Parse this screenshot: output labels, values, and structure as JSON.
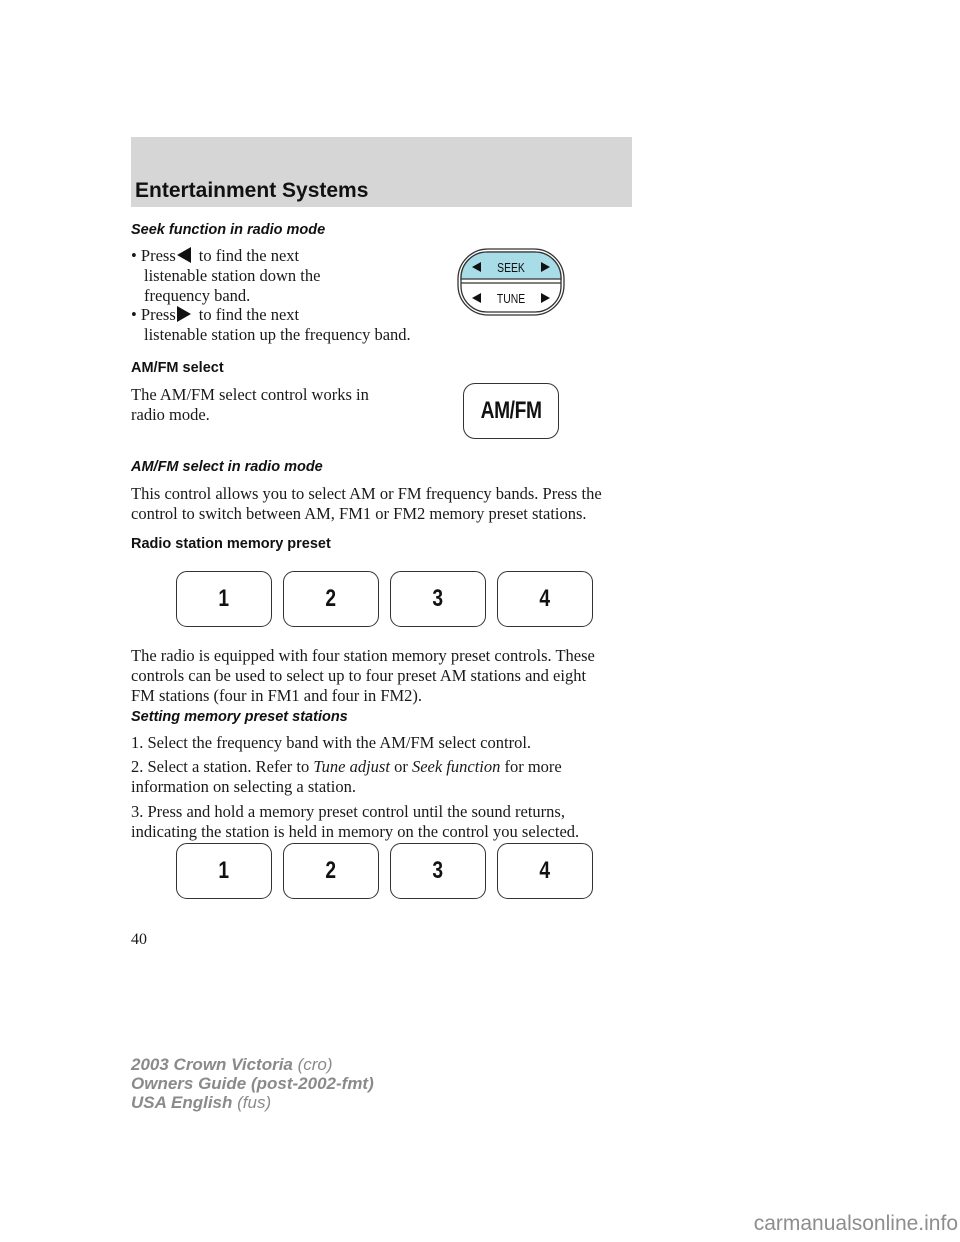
{
  "header": {
    "section_title": "Entertainment Systems"
  },
  "seek": {
    "heading": "Seek function in radio mode",
    "bullets": [
      {
        "prefix": "Press",
        "icon": "triangle-left-icon",
        "line1": "to find the next",
        "line2": "listenable station down the",
        "line3": "frequency band."
      },
      {
        "prefix": "Press",
        "icon": "triangle-right-icon",
        "line1": "to find the next",
        "line2": "listenable station up the frequency band."
      }
    ],
    "control": {
      "seek_label": "SEEK",
      "tune_label": "TUNE",
      "seek_color": "#a8dde8"
    }
  },
  "amfm": {
    "heading": "AM/FM select",
    "text_line1": "The AM/FM select control works in",
    "text_line2": "radio mode.",
    "button_label": "AM/FM"
  },
  "amfm_radio": {
    "heading": "AM/FM select in radio mode",
    "text_line1": "This control allows you to select AM or FM frequency bands. Press the",
    "text_line2": "control to switch between AM, FM1 or FM2 memory preset stations."
  },
  "presets": {
    "heading": "Radio station memory preset",
    "buttons": [
      "1",
      "2",
      "3",
      "4"
    ],
    "text_line1": "The radio is equipped with four station memory preset controls. These",
    "text_line2": "controls can be used to select up to four preset AM stations and eight",
    "text_line3": "FM stations (four in FM1 and four in FM2)."
  },
  "setting": {
    "heading": "Setting memory preset stations",
    "step1": "1. Select the frequency band with the AM/FM select control.",
    "step2_a": "2. Select a station. Refer to ",
    "step2_link1": "Tune adjust",
    "step2_b": " or ",
    "step2_link2": "Seek function",
    "step2_c": " for more",
    "step2_line2": "information on selecting a station.",
    "step3_line1": "3. Press and hold a memory preset control until the sound returns,",
    "step3_line2": "indicating the station is held in memory on the control you selected.",
    "buttons": [
      "1",
      "2",
      "3",
      "4"
    ]
  },
  "page_number": "40",
  "footer": {
    "line1_bold": "2003 Crown Victoria",
    "line1_light": " (cro)",
    "line2_bold": "Owners Guide (post-2002-fmt)",
    "line3_bold": "USA English",
    "line3_light": " (fus)"
  },
  "watermark": "carmanualsonline.info"
}
